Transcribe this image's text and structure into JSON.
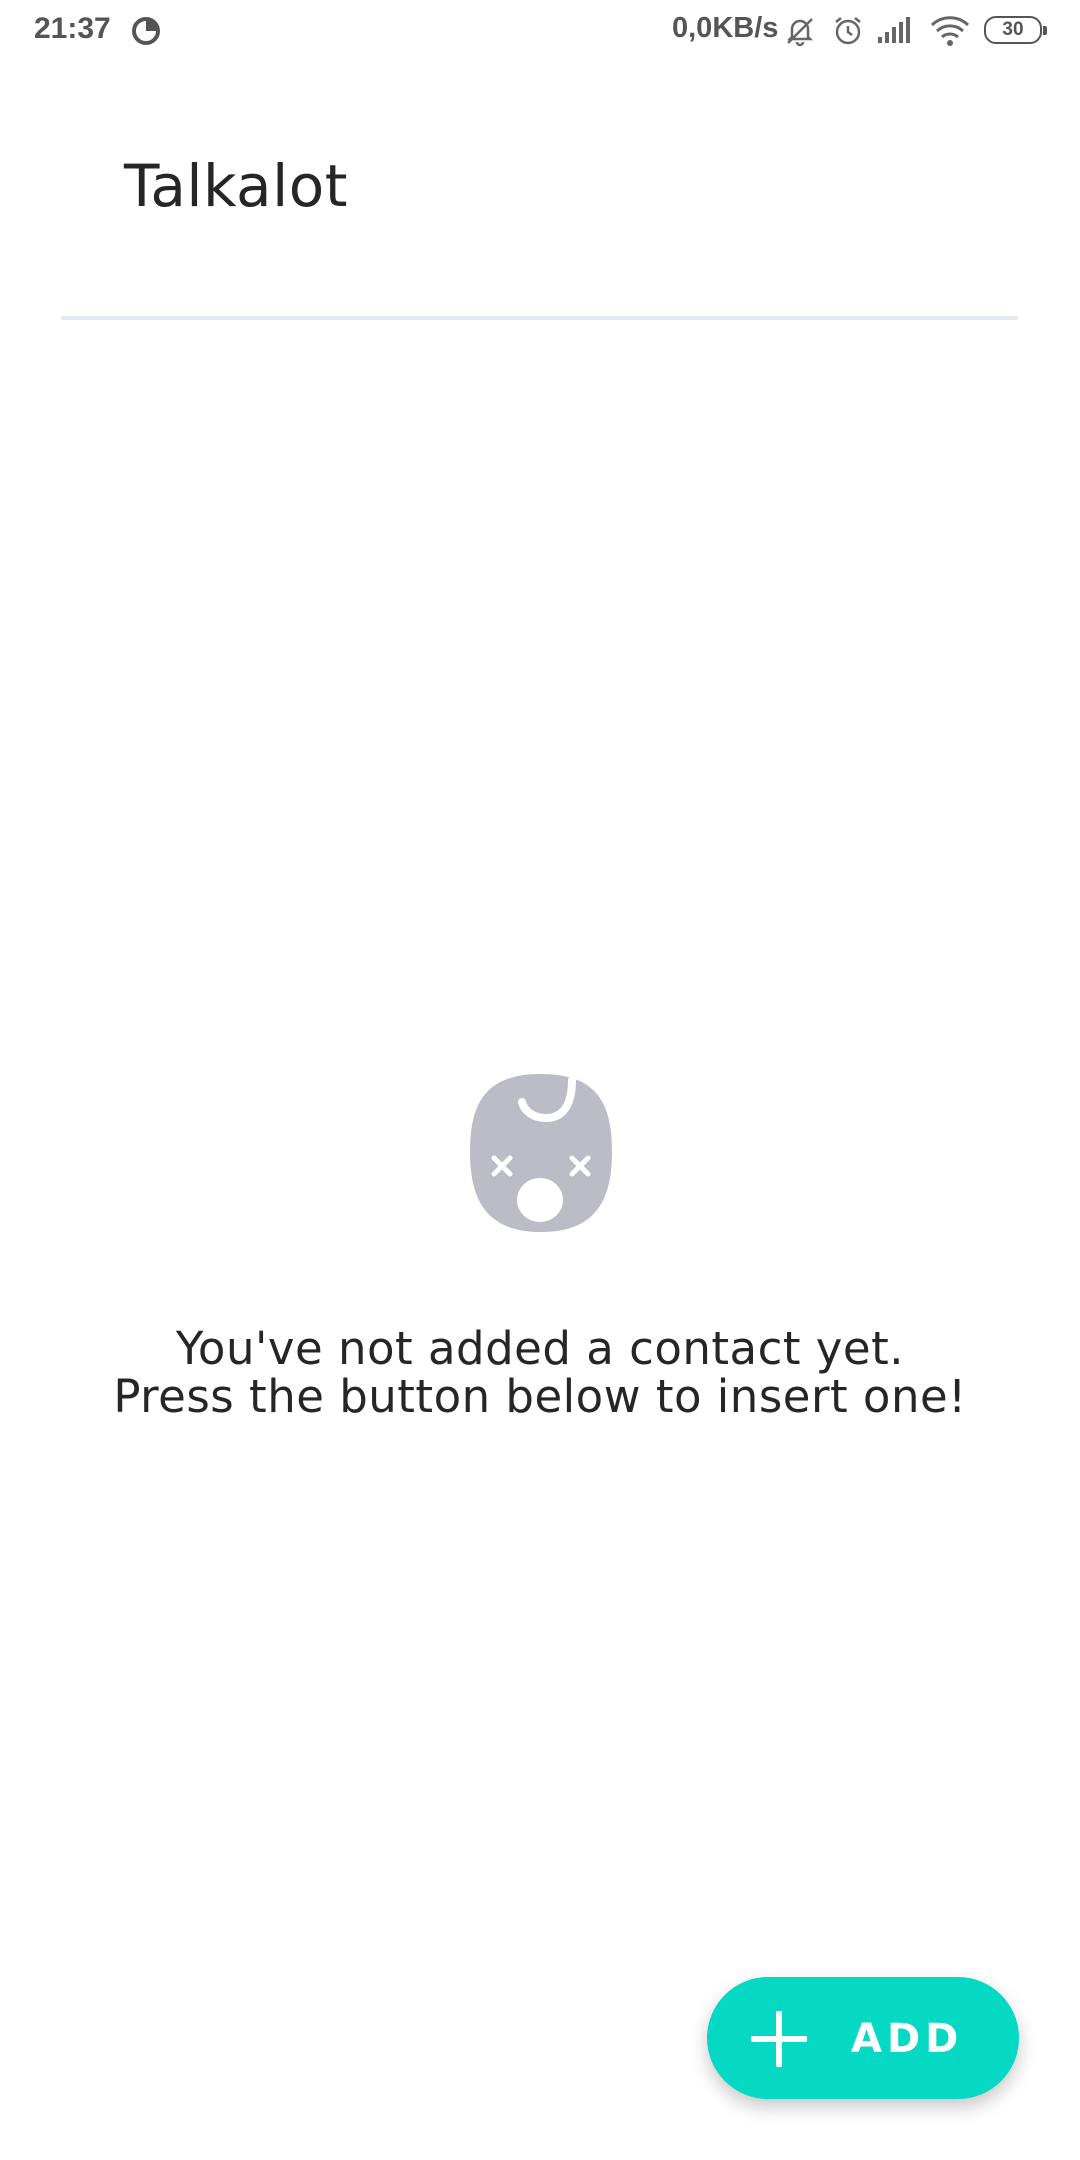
{
  "status_bar": {
    "time": "21:37",
    "network_speed": "0,0KB/s",
    "battery": "30",
    "icons": [
      "app-notification-icon",
      "bell-muted-icon",
      "alarm-icon",
      "signal-icon",
      "wifi-icon",
      "battery-icon"
    ]
  },
  "header": {
    "title": "Talkalot"
  },
  "empty_state": {
    "icon": "sad-face-icon",
    "line1": "You've not added a contact yet.",
    "line2": "Press the button below to insert one!"
  },
  "fab": {
    "icon": "plus-icon",
    "label": "ADD"
  },
  "colors": {
    "accent": "#05d8c3",
    "empty_icon": "#bcbcc7",
    "divider": "#e3e9ef",
    "text": "#262626"
  }
}
